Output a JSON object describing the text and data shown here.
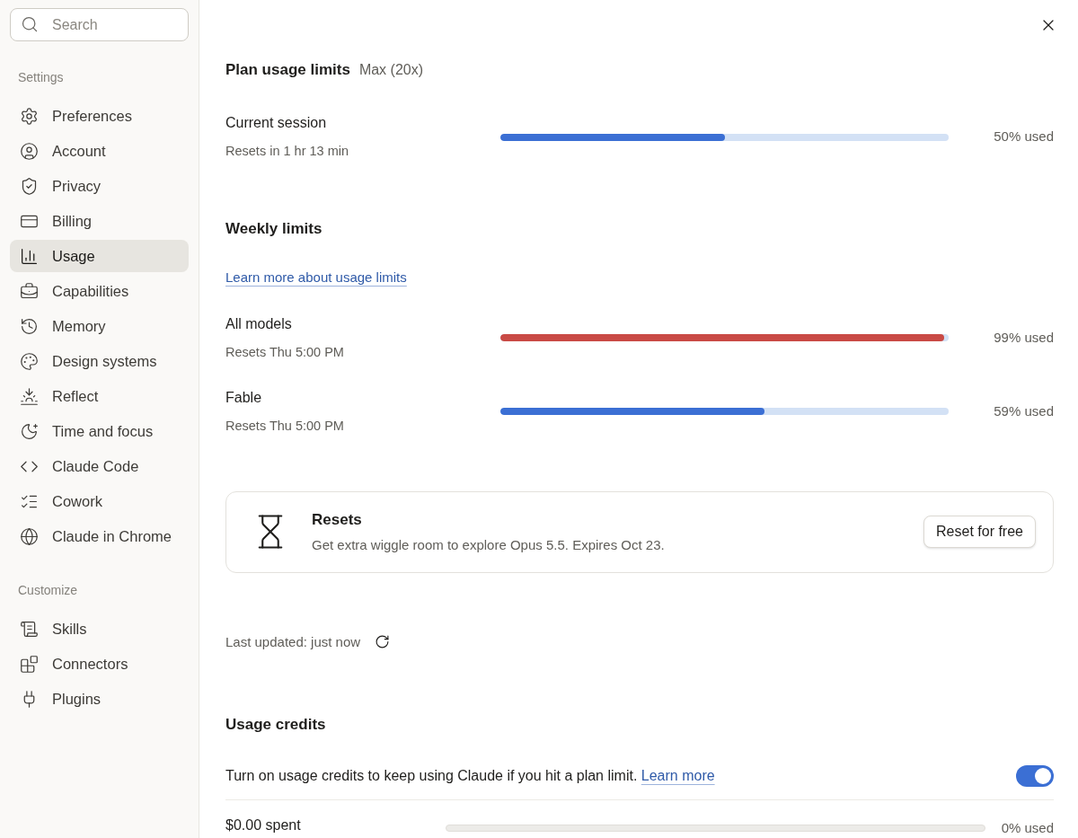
{
  "sidebar": {
    "search": {
      "placeholder": "Search"
    },
    "sections": [
      {
        "heading": "Settings",
        "items": [
          {
            "label": "Preferences",
            "selected": false
          },
          {
            "label": "Account",
            "selected": false
          },
          {
            "label": "Privacy",
            "selected": false
          },
          {
            "label": "Billing",
            "selected": false
          },
          {
            "label": "Usage",
            "selected": true
          },
          {
            "label": "Capabilities",
            "selected": false
          },
          {
            "label": "Memory",
            "selected": false
          },
          {
            "label": "Design systems",
            "selected": false
          },
          {
            "label": "Reflect",
            "selected": false
          },
          {
            "label": "Time and focus",
            "selected": false
          },
          {
            "label": "Claude Code",
            "selected": false
          },
          {
            "label": "Cowork",
            "selected": false
          },
          {
            "label": "Claude in Chrome",
            "selected": false
          }
        ]
      },
      {
        "heading": "Customize",
        "items": [
          {
            "label": "Skills",
            "selected": false
          },
          {
            "label": "Connectors",
            "selected": false
          },
          {
            "label": "Plugins",
            "selected": false
          }
        ]
      }
    ]
  },
  "plan": {
    "title": "Plan usage limits",
    "plan_name": "Max (20x)",
    "session": {
      "name": "Current session",
      "subtitle": "Resets in 1 hr 13 min",
      "level": 0.5,
      "reading": "50% used",
      "color": "#3b6fd4"
    }
  },
  "weekly": {
    "title": "Weekly limits",
    "link": "Learn more about usage limits",
    "limits": [
      {
        "name": "All models",
        "subtitle": "Resets Thu 5:00 PM",
        "level": 0.99,
        "reading": "99% used",
        "color": "#c94a45"
      },
      {
        "name": "Fable",
        "subtitle": "Resets Thu 5:00 PM",
        "level": 0.59,
        "reading": "59% used",
        "color": "#3b6fd4"
      }
    ]
  },
  "resets_card": {
    "title": "Resets",
    "description": "Get extra wiggle room to explore Opus 5.5. Expires Oct 23.",
    "button": "Reset for free"
  },
  "last_updated": "Last updated: just now",
  "credits": {
    "title": "Usage credits",
    "text": "Turn on usage credits to keep using Claude if you hit a plan limit.",
    "link": "Learn more",
    "on": true,
    "spent": "$0.00 spent",
    "reading": "0% used"
  }
}
